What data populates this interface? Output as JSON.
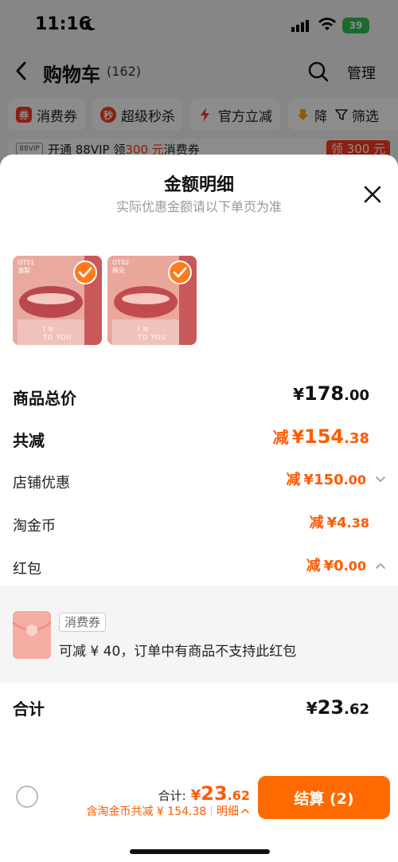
{
  "status": {
    "time": "11:16",
    "battery": "39"
  },
  "nav": {
    "title": "购物车",
    "count": "(162)",
    "manage": "管理"
  },
  "chips": [
    {
      "label": "消费券",
      "icon_color": "#ff3a1f"
    },
    {
      "label": "超级秒杀",
      "icon_color": "#ff3a1f"
    },
    {
      "label": "官方立减",
      "icon_color": "#ff3a1f"
    },
    {
      "label": "降",
      "icon_color": "#ffa500"
    }
  ],
  "filter_label": "筛选",
  "vip": {
    "logo": "88VIP",
    "text_pre": "开通 88VIP 领",
    "amount": "300 元",
    "text_post": "消费券",
    "button": "领 300 元"
  },
  "sheet": {
    "title": "金额明细",
    "subtitle": "实际优惠金额请以下单页为准",
    "thumbs": [
      {
        "code": "OT01",
        "name": "油梨",
        "brand_line1": "I N",
        "brand_line2": "TO YOU"
      },
      {
        "code": "OT02",
        "name": "枫尖",
        "brand_line1": "I N",
        "brand_line2": "TO YOU"
      }
    ],
    "rows": {
      "goods_total": {
        "label": "商品总价",
        "cur": "¥",
        "int": "178",
        "dec": ".00"
      },
      "total_reduce": {
        "label": "共减",
        "prefix": "减",
        "cur": "¥",
        "int": "154",
        "dec": ".38"
      },
      "shop_discount": {
        "label": "店铺优惠",
        "prefix": "减",
        "cur": "¥",
        "int": "150",
        "dec": ".00"
      },
      "taojinbi": {
        "label": "淘金币",
        "prefix": "减",
        "cur": "¥",
        "int": "4",
        "dec": ".38"
      },
      "red_packet": {
        "label": "红包",
        "prefix": "减",
        "cur": "¥",
        "int": "0",
        "dec": ".00"
      }
    },
    "coupon": {
      "tag": "消费券",
      "desc": "可减 ¥ 40，订单中有商品不支持此红包"
    },
    "total": {
      "label": "合计",
      "cur": "¥",
      "int": "23",
      "dec": ".62"
    }
  },
  "bottom": {
    "sum_label": "合计:",
    "sum_cur": "¥",
    "sum_int": "23",
    "sum_dec": ".62",
    "detail_text": "含淘金币共减 ¥ 154.38",
    "detail_sep": "|",
    "detail_link": "明细",
    "checkout": "结算 (2)"
  },
  "colors": {
    "accent": "#ff5a00",
    "checkout": "#ff6a00",
    "check_badge": "#ff7a1a"
  }
}
